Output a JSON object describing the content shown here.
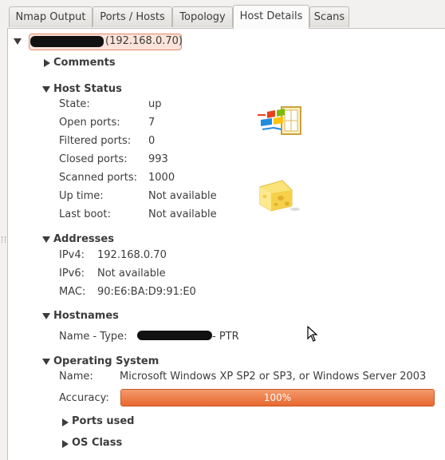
{
  "tabs": [
    {
      "label": "Nmap Output",
      "active": false
    },
    {
      "label": "Ports / Hosts",
      "active": false
    },
    {
      "label": "Topology",
      "active": false
    },
    {
      "label": "Host Details",
      "active": true
    },
    {
      "label": "Scans",
      "active": false
    }
  ],
  "host": {
    "address": "(192.168.0.70)"
  },
  "comments": {
    "title": "Comments"
  },
  "host_status": {
    "title": "Host Status",
    "rows": [
      {
        "label": "State:",
        "value": "up"
      },
      {
        "label": "Open ports:",
        "value": "7"
      },
      {
        "label": "Filtered ports:",
        "value": "0"
      },
      {
        "label": "Closed ports:",
        "value": "993"
      },
      {
        "label": "Scanned ports:",
        "value": "1000"
      },
      {
        "label": "Up time:",
        "value": "Not available"
      },
      {
        "label": "Last boot:",
        "value": "Not available"
      }
    ],
    "os_icon": "windows-logo-icon",
    "vuln_icon": "cheese-icon"
  },
  "addresses": {
    "title": "Addresses",
    "rows": [
      {
        "label": "IPv4:",
        "value": "192.168.0.70"
      },
      {
        "label": "IPv6:",
        "value": "Not available"
      },
      {
        "label": "MAC:",
        "value": "90:E6:BA:D9:91:E0"
      }
    ]
  },
  "hostnames": {
    "title": "Hostnames",
    "label": "Name - Type:",
    "type_suffix": "- PTR"
  },
  "operating_system": {
    "title": "Operating System",
    "name_label": "Name:",
    "name_value": "Microsoft Windows XP SP2 or SP3, or Windows Server 2003",
    "accuracy_label": "Accuracy:",
    "accuracy_value": 1.0,
    "accuracy_text": "100%",
    "ports_used": "Ports used",
    "os_class": "OS Class"
  },
  "colors": {
    "accent": "#e8672f",
    "redaction": "#111111",
    "host_badge": "#fbe3d9"
  }
}
